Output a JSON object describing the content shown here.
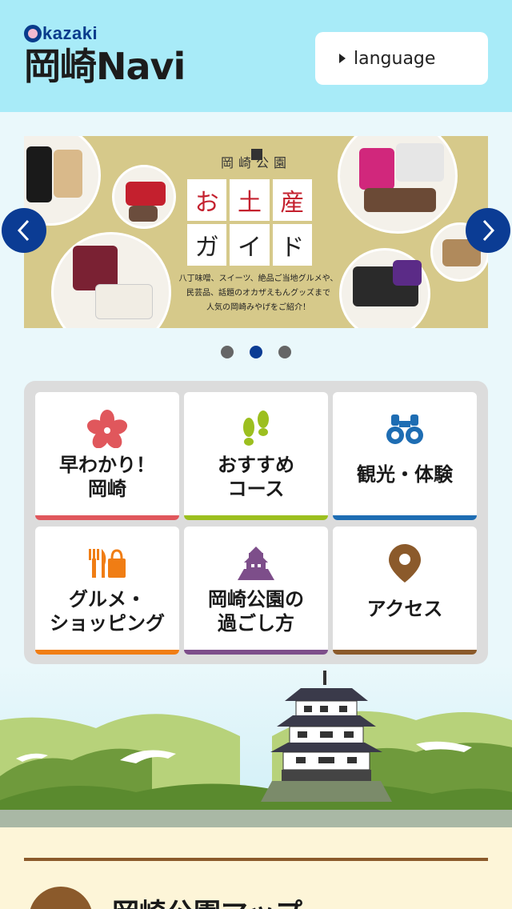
{
  "header": {
    "logo_small": "kazaki",
    "logo_main": "岡崎Navi",
    "language_label": "language",
    "bg_color": "#a8ebf8"
  },
  "carousel": {
    "prev_icon": "chevron-left-icon",
    "next_icon": "chevron-right-icon",
    "banner": {
      "title_top": "岡崎公園",
      "grid": [
        "お",
        "土",
        "産",
        "ガ",
        "イ",
        "ド"
      ],
      "subtitle_line1": "八丁味噌、スイーツ、絶品ご当地グルメや、",
      "subtitle_line2": "民芸品、話題のオカザえもんグッズまで",
      "subtitle_line3": "人気の岡崎みやげをご紹介！"
    },
    "slide_count": 3,
    "active_slide": 2
  },
  "menu": {
    "tiles": [
      {
        "label": "早わかり！\n岡崎",
        "icon": "sakura-icon",
        "color": "#e0575c"
      },
      {
        "label": "おすすめ\nコース",
        "icon": "footprints-icon",
        "color": "#9cbf1f"
      },
      {
        "label": "観光・体験",
        "icon": "binoculars-icon",
        "color": "#1e6db3"
      },
      {
        "label": "グルメ・\nショッピング",
        "icon": "fork-knife-bag-icon",
        "color": "#f07d14"
      },
      {
        "label": "岡崎公園の\n過ごし方",
        "icon": "castle-icon",
        "color": "#7d4e8a"
      },
      {
        "label": "アクセス",
        "icon": "map-pin-icon",
        "color": "#8b5a2b"
      }
    ]
  },
  "footer": {
    "map_title": "岡崎公園マップ",
    "accent": "#8b5a2b"
  }
}
